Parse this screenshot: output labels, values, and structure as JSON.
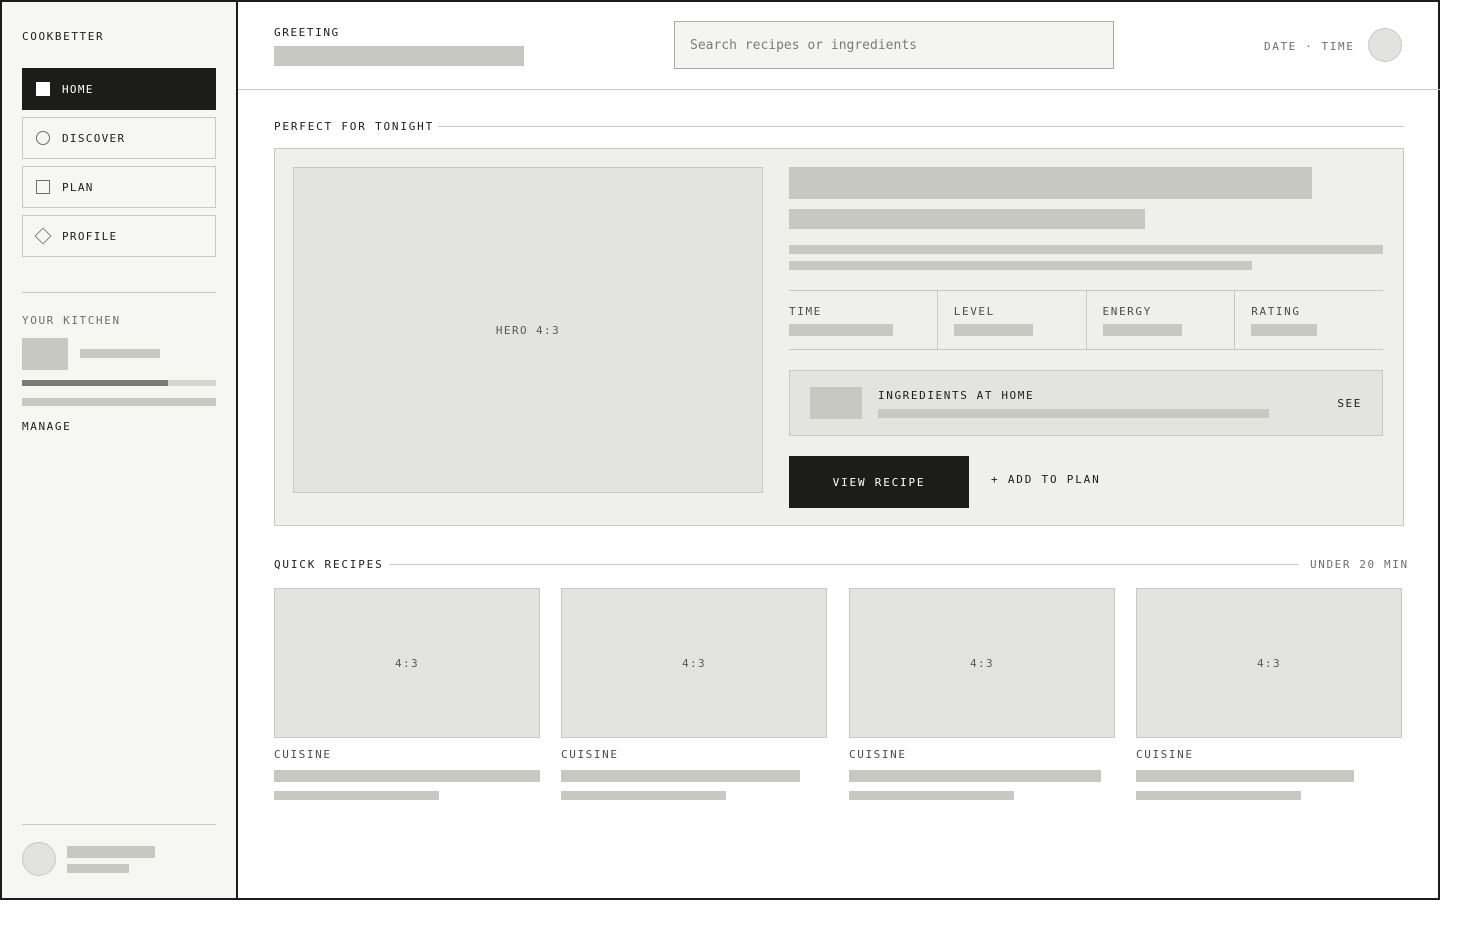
{
  "app": {
    "brand": "COOKBETTER"
  },
  "sidebar": {
    "nav": [
      {
        "label": "HOME",
        "icon": "home-square-icon",
        "active": true
      },
      {
        "label": "DISCOVER",
        "icon": "discover-circle-icon",
        "active": false
      },
      {
        "label": "PLAN",
        "icon": "plan-square-icon",
        "active": false
      },
      {
        "label": "PROFILE",
        "icon": "profile-diamond-icon",
        "active": false
      }
    ],
    "kitchen": {
      "label": "YOUR KITCHEN",
      "progress": 0.75,
      "manage_label": "MANAGE"
    }
  },
  "header": {
    "greeting_label": "GREETING",
    "search_placeholder": "Search recipes or ingredients",
    "datetime": "DATE · TIME"
  },
  "featured": {
    "section_title": "PERFECT FOR TONIGHT",
    "image_label": "HERO 4:3",
    "stats": [
      {
        "label": "TIME"
      },
      {
        "label": "LEVEL"
      },
      {
        "label": "ENERGY"
      },
      {
        "label": "RATING"
      }
    ],
    "ingredients_title": "INGREDIENTS AT HOME",
    "ingredients_action": "SEE",
    "primary_action": "VIEW RECIPE",
    "secondary_action": "+ ADD TO PLAN"
  },
  "quick": {
    "section_title": "QUICK RECIPES",
    "filter_label": "UNDER 20 MIN",
    "cards": [
      {
        "image_label": "4:3",
        "cuisine": "CUISINE"
      },
      {
        "image_label": "4:3",
        "cuisine": "CUISINE"
      },
      {
        "image_label": "4:3",
        "cuisine": "CUISINE"
      },
      {
        "image_label": "4:3",
        "cuisine": "CUISINE"
      }
    ]
  },
  "colors": {
    "ink": "#1c1c1a",
    "placeholder": "#c8c8c2",
    "panel": "#efefeb",
    "sidebar_bg": "#f6f6f3"
  }
}
